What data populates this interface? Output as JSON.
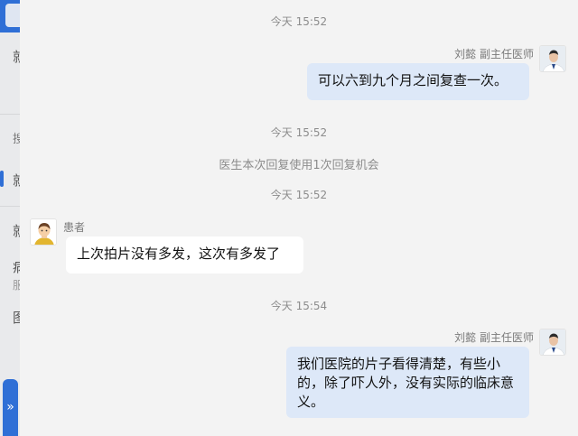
{
  "background": {
    "glyphs": [
      "就",
      "搜",
      "就",
      "就",
      "病",
      "服",
      "图"
    ],
    "expand_icon_glyph": "»"
  },
  "chat": {
    "messages": [
      {
        "type": "timestamp",
        "text": "今天 15:52"
      },
      {
        "type": "message",
        "side": "right",
        "sender": "刘懿 副主任医师",
        "text": "可以六到九个月之间复查一次。"
      },
      {
        "type": "timestamp",
        "text": "今天 15:52"
      },
      {
        "type": "system",
        "text": "医生本次回复使用1次回复机会"
      },
      {
        "type": "timestamp",
        "text": "今天 15:52"
      },
      {
        "type": "message",
        "side": "left",
        "sender": "患者",
        "text": "上次拍片没有多发，这次有多发了"
      },
      {
        "type": "timestamp",
        "text": "今天 15:54"
      },
      {
        "type": "message",
        "side": "right",
        "sender": "刘懿 副主任医师",
        "text": "我们医院的片子看得清楚，有些小的，除了吓人外，没有实际的临床意义。"
      }
    ]
  },
  "colors": {
    "accent": "#2f6fd6",
    "outgoing_bubble": "#dde8f8",
    "incoming_bubble": "#ffffff",
    "background": "#f3f3f3"
  }
}
